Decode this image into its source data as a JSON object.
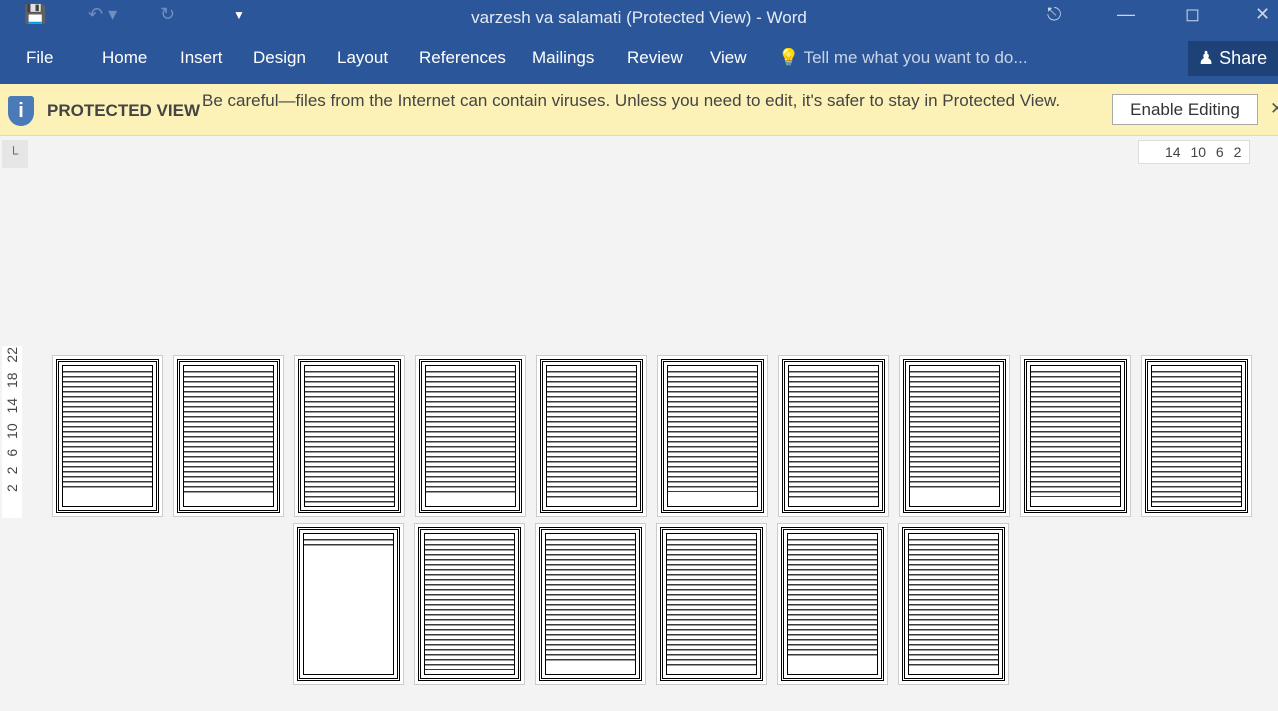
{
  "window": {
    "title": "varzesh va salamati (Protected View) - Word"
  },
  "ribbon": {
    "tabs": [
      "File",
      "Home",
      "Insert",
      "Design",
      "Layout",
      "References",
      "Mailings",
      "Review",
      "View"
    ],
    "tell_me": "Tell me what you want to do...",
    "share": "Share"
  },
  "protected_view": {
    "label": "PROTECTED VIEW",
    "message": "Be careful—files from the Internet can contain viruses. Unless you need to edit, it's safer to stay in Protected View.",
    "enable_button": "Enable Editing"
  },
  "rulers": {
    "horizontal": "14 10 6 2",
    "vertical": "2 2 6 10 14 18 22"
  },
  "colors": {
    "accent": "#2b579a",
    "warning_bar": "#fcf1b6"
  }
}
